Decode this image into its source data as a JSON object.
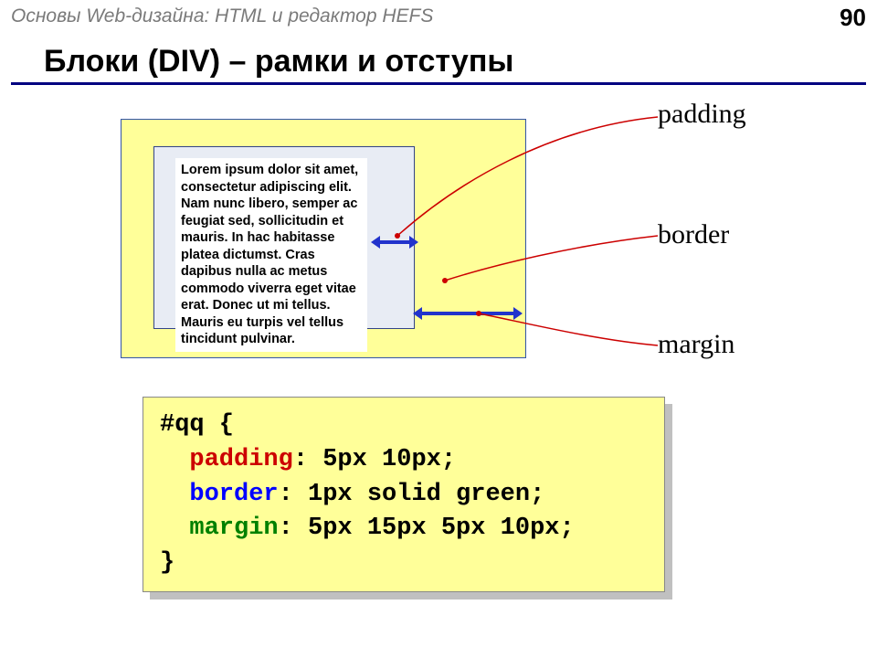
{
  "header": {
    "breadcrumb": "Основы Web-дизайна: HTML и редактор HEFS",
    "page_number": "90"
  },
  "title": "Блоки (DIV) – рамки и отступы",
  "labels": {
    "padding": "padding",
    "border": "border",
    "margin": "margin"
  },
  "content_text": "Lorem ipsum dolor sit amet, consectetur adipiscing elit. Nam nunc libero, semper ac feugiat sed, sollicitudin et mauris. In hac habitasse platea dictumst. Cras dapibus nulla ac metus commodo viverra eget vitae erat. Donec ut mi tellus. Mauris eu turpis vel tellus tincidunt pulvinar.",
  "code": {
    "selector": "#qq {",
    "padding_kw": "padding",
    "padding_rest": ": 5px 10px;",
    "border_kw": "border",
    "border_rest": ": 1px solid green;",
    "margin_kw": "margin",
    "margin_rest": ": 5px 15px 5px 10px;",
    "close": "}"
  }
}
